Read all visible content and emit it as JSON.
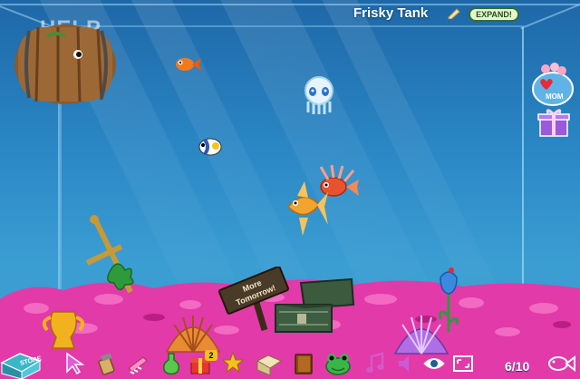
{
  "tank": {
    "title": "Frisky Tank",
    "expand_label": "EXPAND!",
    "help_label": "HELP",
    "sign_text_line1": "More",
    "sign_text_line2": "Tomorrow!"
  },
  "side_buttons": {
    "mom_label": "MOM"
  },
  "toolbar": {
    "store_label": "STORE",
    "badge_count": "2",
    "fish_count": "6/10"
  },
  "icons": [
    "edit-icon",
    "heart-mom-icon",
    "gift-icon",
    "store-icon",
    "cursor-icon",
    "food-shaker-icon",
    "scrub-brush-icon",
    "potion-icon",
    "gift-box-icon",
    "star-trophy-icon",
    "folder-tools-icon",
    "book-icon",
    "frog-icon",
    "music-icon",
    "sound-icon",
    "eye-icon",
    "fullscreen-icon",
    "fish-count-icon"
  ],
  "colors": {
    "water_top": "#1e67a7",
    "water_bottom": "#3a98cd",
    "gravel": "#e23aa8",
    "expand_bg": "#e9f5c8"
  }
}
